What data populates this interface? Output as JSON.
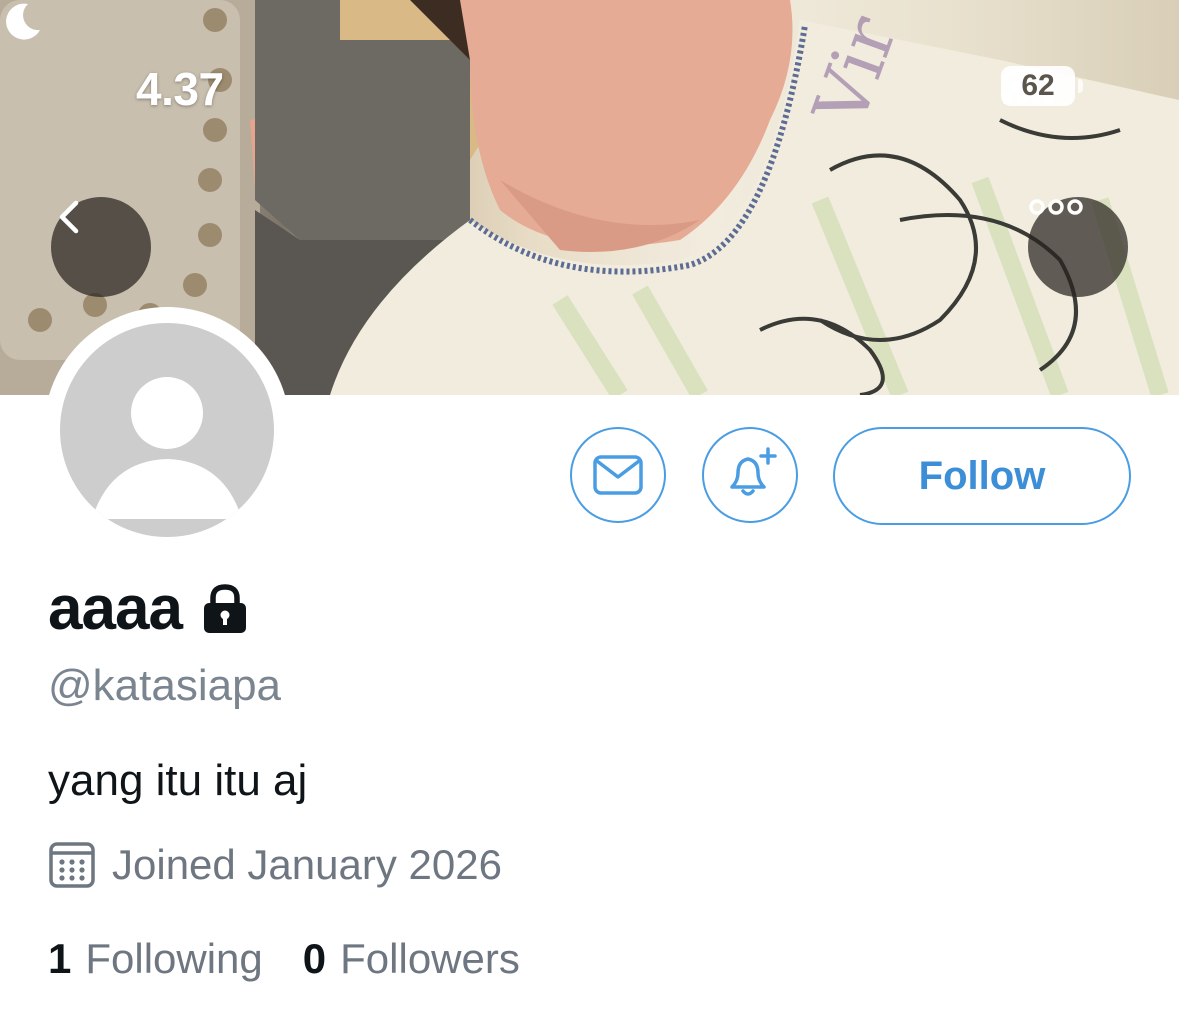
{
  "status_bar": {
    "time": "4.37",
    "battery": "62"
  },
  "icons": {
    "moon": "moon-icon",
    "signal": "cellular-signal-icon",
    "wifi": "wifi-icon",
    "back": "chevron-left-icon",
    "more": "more-horizontal-icon",
    "message": "envelope-icon",
    "notify": "bell-plus-icon",
    "lock": "lock-icon",
    "calendar": "calendar-icon",
    "avatar": "default-avatar-icon"
  },
  "profile": {
    "display_name": "aaaa",
    "handle": "@katasiapa",
    "bio": "yang itu itu aj",
    "joined": "Joined January 2026"
  },
  "actions": {
    "follow_label": "Follow"
  },
  "stats": {
    "following_count": "1",
    "following_label": "Following",
    "followers_count": "0",
    "followers_label": "Followers"
  },
  "colors": {
    "accent": "#4a9de3",
    "secondary_text": "#6e7781",
    "primary_text": "#0f1419"
  }
}
